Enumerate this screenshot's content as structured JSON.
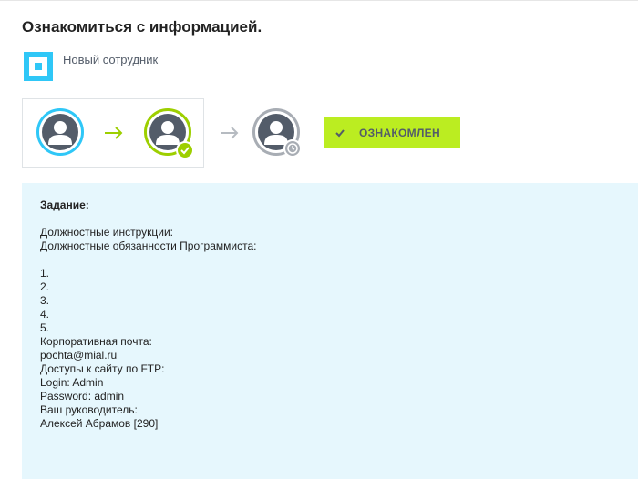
{
  "page": {
    "title": "Ознакомиться с информацией.",
    "document_label": "Новый сотрудник"
  },
  "workflow": {
    "steps": [
      {
        "icon": "user-icon",
        "state": "author",
        "ring_color": "#2fc7f7"
      },
      {
        "icon": "user-icon",
        "state": "done",
        "ring_color": "#9dcf00",
        "badge": "check-icon"
      },
      {
        "icon": "user-icon",
        "state": "waiting",
        "ring_color": "#a8adb4",
        "badge": "clock-icon"
      }
    ],
    "status_button_label": "ОЗНАКОМЛЕН",
    "status_button_color": "#bbed21"
  },
  "task": {
    "heading": "Задание:",
    "lines": [
      "Должностные инструкции:",
      "Должностные обязанности Программиста:",
      "",
      "1.",
      "2.",
      "3.",
      "4.",
      "5.",
      "Корпоративная почта:",
      "pochta@mial.ru",
      "Доступы к сайту по FTP:",
      "Login: Admin",
      "Password: admin",
      "Ваш руководитель:",
      "Алексей Абрамов [290]"
    ],
    "background": "#e6f7fd"
  }
}
